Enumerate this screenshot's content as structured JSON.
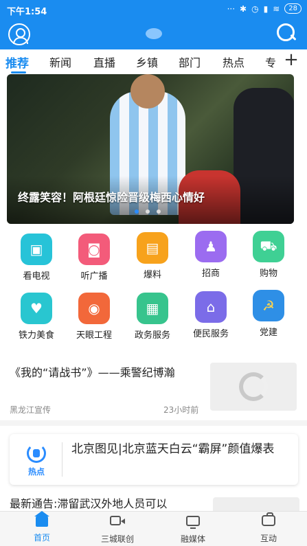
{
  "status_bar": {
    "time": "下午1:54",
    "signal_dots": "···",
    "battery": "28"
  },
  "header": {
    "profile_icon": "person-icon",
    "search_icon": "search-icon",
    "brand_color": "#1a8cf0"
  },
  "tabs": [
    {
      "label": "推荐",
      "active": true
    },
    {
      "label": "新闻"
    },
    {
      "label": "直播"
    },
    {
      "label": "乡镇"
    },
    {
      "label": "部门"
    },
    {
      "label": "热点"
    },
    {
      "label": "专"
    }
  ],
  "tab_add": "+",
  "banner": {
    "caption": "终露笑容！阿根廷惊险晋级梅西心情好",
    "slide_count": 3,
    "active_slide": 1
  },
  "shortcuts": [
    {
      "label": "看电视",
      "icon": "tv-icon",
      "color": "#27c3d8"
    },
    {
      "label": "听广播",
      "icon": "radio-icon",
      "color": "#f35b7a"
    },
    {
      "label": "爆料",
      "icon": "message-icon",
      "color": "#f7a21c"
    },
    {
      "label": "招商",
      "icon": "person-badge-icon",
      "color": "#9b6cf0"
    },
    {
      "label": "购物",
      "icon": "cart-icon",
      "color": "#3fd094"
    },
    {
      "label": "铁力美食",
      "icon": "heart-icon",
      "color": "#29c6d0"
    },
    {
      "label": "天眼工程",
      "icon": "eye-icon",
      "color": "#f2683a"
    },
    {
      "label": "政务服务",
      "icon": "id-card-icon",
      "color": "#37c48d"
    },
    {
      "label": "便民服务",
      "icon": "home-face-icon",
      "color": "#7b6ce8"
    },
    {
      "label": "党建",
      "icon": "party-emblem-icon",
      "color": "#2e8fe6"
    }
  ],
  "news": [
    {
      "title": "《我的“请战书”》——乘警纪博瀚",
      "source": "黑龙江宣传",
      "time": "23小时前"
    }
  ],
  "hot_card": {
    "badge_label": "热点",
    "title": "北京图见|北京蓝天白云“霸屏”颜值爆表"
  },
  "partial_news": {
    "title": "最新通告:滞留武汉外地人员可以"
  },
  "bottom_nav": [
    {
      "label": "首页",
      "icon": "home-icon",
      "active": true
    },
    {
      "label": "三城联创",
      "icon": "video-icon"
    },
    {
      "label": "融媒体",
      "icon": "tv-icon"
    },
    {
      "label": "互动",
      "icon": "chat-icon"
    }
  ]
}
